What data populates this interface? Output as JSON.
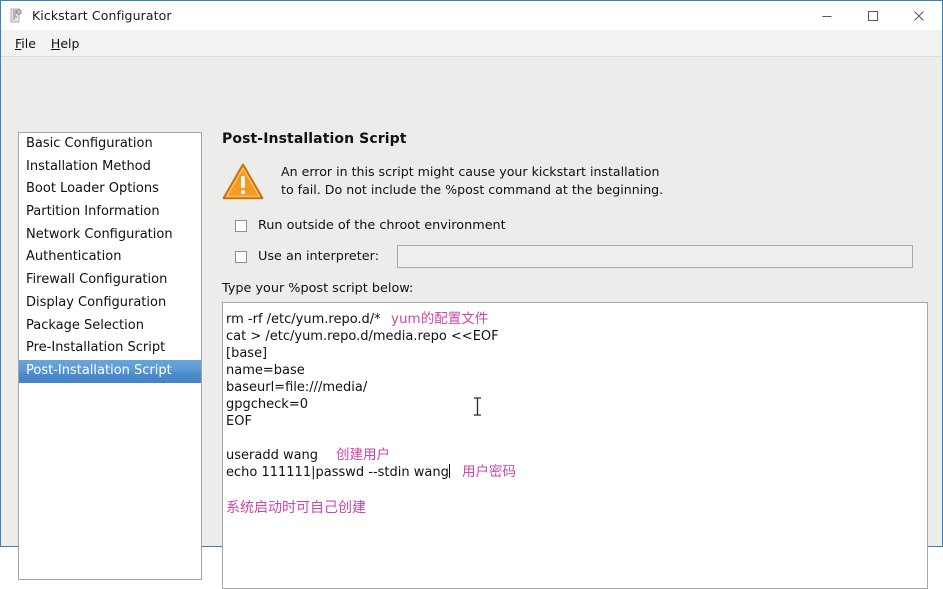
{
  "window": {
    "title": "Kickstart Configurator",
    "app_icon": "kickstart-icon",
    "controls": {
      "minimize": "minimize-icon",
      "maximize": "maximize-icon",
      "close": "close-icon"
    }
  },
  "menubar": {
    "items": [
      {
        "label": "File",
        "mnemonic": "F",
        "rest": "ile"
      },
      {
        "label": "Help",
        "mnemonic": "H",
        "rest": "elp"
      }
    ]
  },
  "sidebar": {
    "items": [
      {
        "label": "Basic Configuration",
        "selected": false
      },
      {
        "label": "Installation Method",
        "selected": false
      },
      {
        "label": "Boot Loader Options",
        "selected": false
      },
      {
        "label": "Partition Information",
        "selected": false
      },
      {
        "label": "Network Configuration",
        "selected": false
      },
      {
        "label": "Authentication",
        "selected": false
      },
      {
        "label": "Firewall Configuration",
        "selected": false
      },
      {
        "label": "Display Configuration",
        "selected": false
      },
      {
        "label": "Package Selection",
        "selected": false
      },
      {
        "label": "Pre-Installation Script",
        "selected": false
      },
      {
        "label": "Post-Installation Script",
        "selected": true
      }
    ],
    "selected_index": 10,
    "selection_color": "#5b9ad6"
  },
  "main": {
    "title": "Post-Installation Script",
    "warning": {
      "icon": "warning-triangle-icon",
      "icon_color": "#f08a1e",
      "line1": "An error in this script might cause your kickstart installation",
      "line2": "to fail. Do not include the %post command at the beginning."
    },
    "chroot_checkbox": {
      "label": "Run outside of the chroot environment",
      "checked": false
    },
    "interpreter_checkbox": {
      "label": "Use an interpreter:",
      "checked": false
    },
    "interpreter_input": {
      "value": "",
      "placeholder": "",
      "enabled": false
    },
    "script_label": "Type your %post script below:",
    "script_lines": [
      "rm -rf /etc/yum.repo.d/*",
      "cat > /etc/yum.repo.d/media.repo <<EOF",
      "[base]",
      "name=base",
      "baseurl=file:///media/",
      "gpgcheck=0",
      "EOF",
      "",
      "useradd wang",
      "echo 111111|passwd --stdin wang"
    ],
    "annotations": {
      "color": "#cc47a8",
      "yum_config": "yum的配置文件",
      "create_user": "创建用户",
      "user_password": "用户密码",
      "boot_note": "系统启动时可自己创建"
    },
    "text_caret_after": "echo 111111|passwd --stdin wang",
    "mouse_cursor": "i-beam-cursor"
  }
}
